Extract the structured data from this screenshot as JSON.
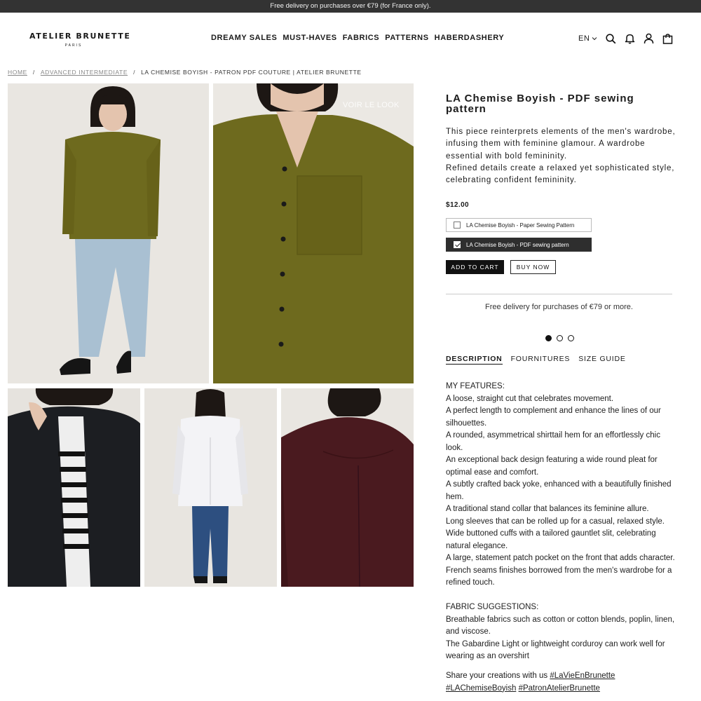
{
  "announcement": "Free delivery on purchases over €79 (for France only).",
  "logo": {
    "name": "ATELIER BRUNETTE",
    "city": "PARIS"
  },
  "nav": [
    "DREAMY SALES",
    "MUST-HAVES",
    "FABRICS",
    "PATTERNS",
    "HABERDASHERY"
  ],
  "header": {
    "language": "EN",
    "icons": [
      "search-icon",
      "bell-icon",
      "account-icon",
      "cart-icon"
    ]
  },
  "breadcrumb": {
    "home": "HOME",
    "sep1": "/",
    "category": "ADVANCED INTERMEDIATE",
    "sep2": "/",
    "current": "LA CHEMISE BOYISH - PATRON PDF COUTURE | ATELIER BRUNETTE"
  },
  "gallery": {
    "look_label": "VOIR LE LOOK"
  },
  "product": {
    "title": "LA Chemise Boyish - PDF sewing pattern",
    "intro_1": "This piece reinterprets elements of the men's wardrobe, infusing them with feminine glamour. A wardrobe essential with bold femininity.",
    "intro_2": "Refined details create a relaxed yet sophisticated style, celebrating confident femininity.",
    "price": "$12.00",
    "options": [
      {
        "label": "LA Chemise Boyish - Paper Sewing Pattern",
        "checked": false
      },
      {
        "label": "LA Chemise Boyish - PDF sewing pattern",
        "checked": true
      }
    ],
    "add_to_cart": "ADD TO CART",
    "buy_now": "BUY NOW",
    "delivery_note": "Free delivery for purchases of €79 or more."
  },
  "tabs": [
    "DESCRIPTION",
    "FOURNITURES",
    "SIZE GUIDE"
  ],
  "description": {
    "features_heading": "MY FEATURES:",
    "features": [
      "A loose, straight cut that celebrates movement.",
      "A perfect length to complement and enhance the lines of our silhouettes.",
      "A rounded, asymmetrical shirttail hem for an effortlessly chic look.",
      "An exceptional back design featuring a wide round pleat for optimal ease and comfort.",
      "A subtly crafted back yoke, enhanced with a beautifully finished hem.",
      "A traditional stand collar that balances its feminine allure.",
      "Long sleeves that can be rolled up for a casual, relaxed style.",
      "Wide buttoned cuffs with a tailored gauntlet slit, celebrating natural elegance.",
      "A large, statement patch pocket on the front that adds character.",
      "French seams finishes borrowed from the men's wardrobe for a refined touch."
    ],
    "fabric_heading": "FABRIC SUGGESTIONS:",
    "fabrics": [
      "Breathable fabrics such as cotton or cotton blends, poplin, linen, and viscose.",
      "The Gabardine Light or lightweight corduroy can work well for wearing as an overshirt"
    ],
    "share_text": "Share your creations with us",
    "hashtags": [
      "#LaVieEnBrunette",
      "#LAChemiseBoyish",
      "#PatronAtelierBrunette"
    ]
  },
  "colors": {
    "olive": "#6e6a1e",
    "black": "#1c1e22",
    "burgundy": "#4a1a1f",
    "announcement_bg": "#333333"
  }
}
